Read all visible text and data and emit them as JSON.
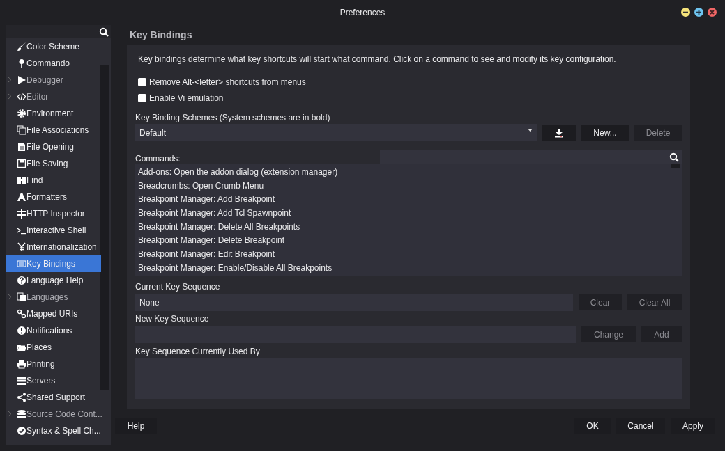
{
  "window": {
    "title": "Preferences"
  },
  "sidebar": {
    "items": [
      {
        "label": "Color Scheme",
        "selected": false,
        "expandable": false
      },
      {
        "label": "Commando",
        "selected": false,
        "expandable": false
      },
      {
        "label": "Debugger",
        "selected": false,
        "expandable": true
      },
      {
        "label": "Editor",
        "selected": false,
        "expandable": true
      },
      {
        "label": "Environment",
        "selected": false,
        "expandable": false
      },
      {
        "label": "File Associations",
        "selected": false,
        "expandable": false
      },
      {
        "label": "File Opening",
        "selected": false,
        "expandable": false
      },
      {
        "label": "File Saving",
        "selected": false,
        "expandable": false
      },
      {
        "label": "Find",
        "selected": false,
        "expandable": false
      },
      {
        "label": "Formatters",
        "selected": false,
        "expandable": false
      },
      {
        "label": "HTTP Inspector",
        "selected": false,
        "expandable": false
      },
      {
        "label": "Interactive Shell",
        "selected": false,
        "expandable": false
      },
      {
        "label": "Internationalization",
        "selected": false,
        "expandable": false
      },
      {
        "label": "Key Bindings",
        "selected": true,
        "expandable": false
      },
      {
        "label": "Language Help",
        "selected": false,
        "expandable": false
      },
      {
        "label": "Languages",
        "selected": false,
        "expandable": true
      },
      {
        "label": "Mapped URIs",
        "selected": false,
        "expandable": false
      },
      {
        "label": "Notifications",
        "selected": false,
        "expandable": false
      },
      {
        "label": "Places",
        "selected": false,
        "expandable": false
      },
      {
        "label": "Printing",
        "selected": false,
        "expandable": false
      },
      {
        "label": "Servers",
        "selected": false,
        "expandable": false
      },
      {
        "label": "Shared Support",
        "selected": false,
        "expandable": false
      },
      {
        "label": "Source Code Cont...",
        "selected": false,
        "expandable": true
      },
      {
        "label": "Syntax & Spell Ch...",
        "selected": false,
        "expandable": false
      }
    ]
  },
  "page": {
    "title": "Key Bindings",
    "description": "Key bindings determine what key shortcuts will start what command. Click on a command to see and modify its key configuration.",
    "options": [
      {
        "label": "Remove Alt-<letter> shortcuts from menus",
        "checked": false
      },
      {
        "label": "Enable Vi emulation",
        "checked": false
      }
    ],
    "schemes": {
      "label": "Key Binding Schemes (System schemes are in bold)",
      "value": "Default",
      "buttons": [
        {
          "label": "New...",
          "disabled": false
        },
        {
          "label": "Delete",
          "disabled": true
        }
      ]
    },
    "commands": {
      "label": "Commands:",
      "rows": [
        "Add-ons: Open the addon dialog (extension manager)",
        "Breadcrumbs: Open Crumb Menu",
        "Breakpoint Manager: Add Breakpoint",
        "Breakpoint Manager: Add Tcl Spawnpoint",
        "Breakpoint Manager: Delete All Breakpoints",
        "Breakpoint Manager: Delete Breakpoint",
        "Breakpoint Manager: Edit Breakpoint",
        "Breakpoint Manager: Enable/Disable All Breakpoints"
      ]
    },
    "current_key": {
      "label": "Current Key Sequence",
      "value": "None",
      "buttons": [
        {
          "label": "Clear",
          "disabled": true
        },
        {
          "label": "Clear All",
          "disabled": true
        }
      ]
    },
    "new_key": {
      "label": "New Key Sequence",
      "buttons": [
        {
          "label": "Change",
          "disabled": true
        },
        {
          "label": "Add",
          "disabled": true
        }
      ]
    },
    "used_by": {
      "label": "Key Sequence Currently Used By"
    }
  },
  "footer": {
    "help": "Help",
    "buttons": [
      "OK",
      "Cancel",
      "Apply"
    ]
  }
}
